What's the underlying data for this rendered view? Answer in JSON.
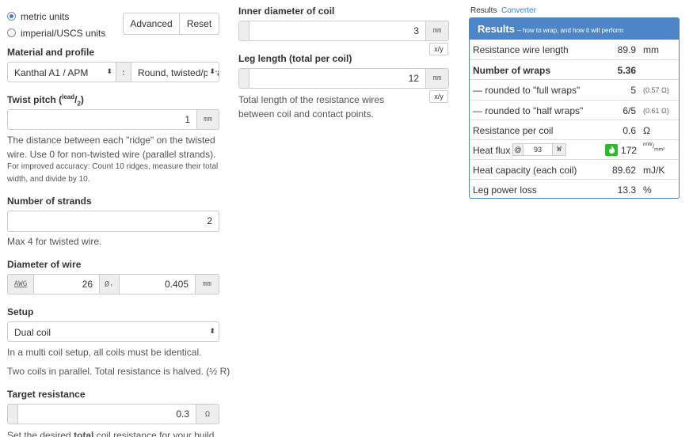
{
  "units": {
    "metric": "metric units",
    "imperial": "imperial/USCS units",
    "selected": "metric"
  },
  "buttons": {
    "advanced": "Advanced",
    "reset": "Reset"
  },
  "material": {
    "label": "Material and profile",
    "material_value": "Kanthal A1 / APM",
    "separator": ":",
    "profile_value": "Round, twisted/parallel"
  },
  "twist": {
    "label_prefix": "Twist pitch (",
    "label_sup": "lead",
    "label_sub": "2",
    "label_suffix": ")",
    "value": "1",
    "unit": "mm",
    "help": "The distance between each \"ridge\" on the twisted wire. Use 0 for non-twisted wire (parallel strands).",
    "help_small": "For improved accuracy: Count 10 ridges, measure their total width, and divide by 10."
  },
  "strands": {
    "label": "Number of strands",
    "value": "2",
    "help": "Max 4 for twisted wire."
  },
  "diameter": {
    "label": "Diameter of wire",
    "awg_label": "AWG",
    "awg_value": "26",
    "dia_symbol": "Øᵣ",
    "dia_value": "0.405",
    "unit": "mm"
  },
  "setup": {
    "label": "Setup",
    "value": "Dual coil",
    "help1": "In a multi coil setup, all coils must be identical.",
    "help2": "Two coils in parallel. Total resistance is halved. (½ R)"
  },
  "target": {
    "label": "Target resistance",
    "value": "0.3",
    "unit": "Ω",
    "help_prefix": "Set the desired ",
    "help_bold": "total",
    "help_suffix": " coil resistance for your build"
  },
  "inner": {
    "label": "Inner diameter of coil",
    "value": "3",
    "unit": "mm",
    "frac": "x/y"
  },
  "leg": {
    "label": "Leg length (total per coil)",
    "value": "12",
    "unit": "mm",
    "frac": "x/y",
    "help": "Total length of the resistance wires between coil and contact points."
  },
  "tabs": {
    "results": "Results",
    "converter": "Converter"
  },
  "results": {
    "title": "Results",
    "subtitle": "– how to wrap, and how it will perform",
    "wire_length": {
      "label": "Resistance wire length",
      "value": "89.9",
      "unit": "mm"
    },
    "wraps": {
      "label": "Number of wraps",
      "value": "5.36"
    },
    "full_wraps": {
      "label": "— rounded to \"full wraps\"",
      "value": "5",
      "note": "(0.57 Ω)"
    },
    "half_wraps": {
      "label": "— rounded to \"half wraps\"",
      "value": "6/5",
      "note": "(0.61 Ω)"
    },
    "resistance": {
      "label": "Resistance per coil",
      "value": "0.6",
      "unit": "Ω"
    },
    "heat_flux": {
      "label": "Heat flux",
      "at": "@",
      "watts": "93",
      "w_unit": "W",
      "value": "172",
      "unit_num": "mW",
      "unit_den": "mm²"
    },
    "heat_capacity": {
      "label": "Heat capacity (each coil)",
      "value": "89.62",
      "unit": "mJ/K"
    },
    "leg_loss": {
      "label": "Leg power loss",
      "value": "13.3",
      "unit": "%"
    }
  },
  "colors": {
    "accent": "#4c86c6",
    "flux_badge": "#2eb82e"
  }
}
